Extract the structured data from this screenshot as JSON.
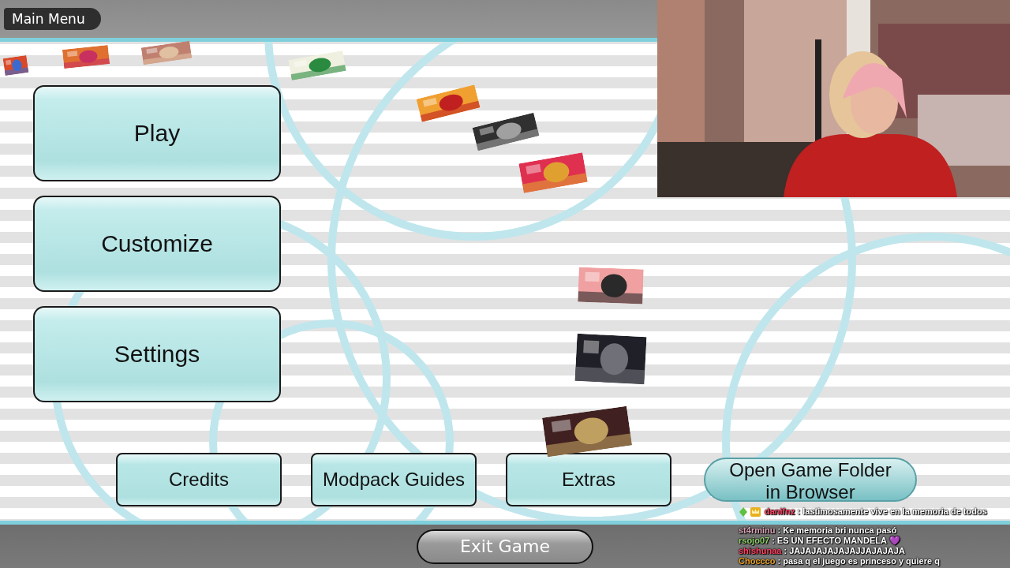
{
  "header": {
    "title": "Main Menu"
  },
  "main_buttons": [
    {
      "label": "Play"
    },
    {
      "label": "Customize"
    },
    {
      "label": "Settings"
    }
  ],
  "bottom_buttons": [
    {
      "label": "Credits",
      "kind": "box"
    },
    {
      "label": "Modpack Guides",
      "kind": "box"
    },
    {
      "label": "Extras",
      "kind": "box"
    },
    {
      "label": "Open Game Folder in Browser",
      "kind": "pill"
    }
  ],
  "exit_button": {
    "label": "Exit Game"
  },
  "chat": [
    {
      "user": "danifnz",
      "color": "#ff4060",
      "message": ": lastimosamente vive en la memoria de todos",
      "badges": true
    },
    {
      "user": "st4rminu",
      "color": "#d9a3b5",
      "message": ": Ke memoria bri nunca pasó",
      "badges": false
    },
    {
      "user": "rsojo07",
      "color": "#8fd06a",
      "message": ": ES UN EFECTO MANDELA 💜",
      "badges": false
    },
    {
      "user": "shishunaa",
      "color": "#ff4060",
      "message": ": JAJAJAJAJAJAJJAJAJAJA",
      "badges": false
    },
    {
      "user": "Choccco",
      "color": "#e8a020",
      "message": ": pasa q el juego es princeso y quiere q",
      "badges": false
    }
  ]
}
